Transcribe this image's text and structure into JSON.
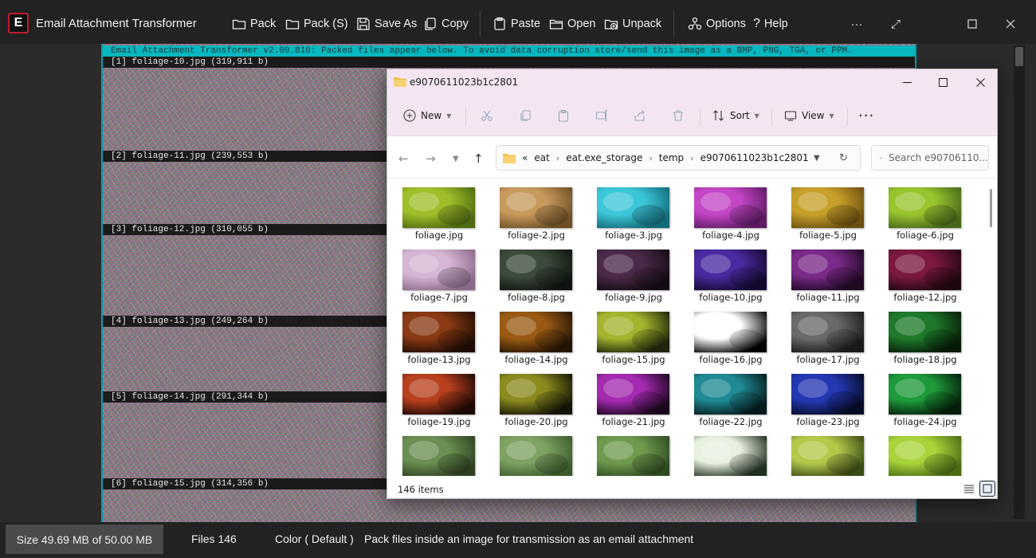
{
  "app": {
    "logo_letter": "E",
    "title": "Email Attachment Transformer",
    "toolbar": {
      "pack": "Pack",
      "pack_s": "Pack (S)",
      "save_as": "Save As",
      "copy": "Copy",
      "paste": "Paste",
      "open": "Open",
      "unpack": "Unpack",
      "options": "Options",
      "help": "Help"
    }
  },
  "image_panel": {
    "header_text": "Email Attachment Transformer v2.00.810: Packed files appear below. To avoid data corruption store/send this image as a BMP, PNG, TGA, or PPM.",
    "files": [
      "[1] foliage-10.jpg (319,911 b)",
      "[2] foliage-11.jpg (239,553 b)",
      "[3] foliage-12.jpg (310,055 b)",
      "[4] foliage-13.jpg (249,264 b)",
      "[5] foliage-14.jpg (291,344 b)",
      "[6] foliage-15.jpg (314,356 b)"
    ]
  },
  "explorer": {
    "title": "e9070611023b1c2801",
    "commands": {
      "new": "New",
      "sort": "Sort",
      "view": "View"
    },
    "breadcrumb": [
      "«",
      "eat",
      "eat.exe_storage",
      "temp",
      "e9070611023b1c2801"
    ],
    "search_placeholder": "Search e90706110...",
    "status_count": "146 items",
    "colors": {
      "title_bg": "#f3e6f2",
      "folder": "#f2c14e"
    },
    "items": [
      {
        "name": "foliage.jpg",
        "color": "#9fbf2a",
        "color2": "#4f6a10"
      },
      {
        "name": "foliage-2.jpg",
        "color": "#c79a5c",
        "color2": "#6e4e24"
      },
      {
        "name": "foliage-3.jpg",
        "color": "#3cc7d8",
        "color2": "#126a78"
      },
      {
        "name": "foliage-4.jpg",
        "color": "#c346c6",
        "color2": "#5e1a62"
      },
      {
        "name": "foliage-5.jpg",
        "color": "#c7a02a",
        "color2": "#6a4e10"
      },
      {
        "name": "foliage-6.jpg",
        "color": "#98c42e",
        "color2": "#47661a"
      },
      {
        "name": "foliage-7.jpg",
        "color": "#d6b6d4",
        "color2": "#8a6a88"
      },
      {
        "name": "foliage-8.jpg",
        "color": "#3c4a3c",
        "color2": "#101410"
      },
      {
        "name": "foliage-9.jpg",
        "color": "#4a2a48",
        "color2": "#140a14"
      },
      {
        "name": "foliage-10.jpg",
        "color": "#4a2aa0",
        "color2": "#14082e"
      },
      {
        "name": "foliage-11.jpg",
        "color": "#7a2a88",
        "color2": "#1e0822"
      },
      {
        "name": "foliage-12.jpg",
        "color": "#7a1840",
        "color2": "#1e0610"
      },
      {
        "name": "foliage-13.jpg",
        "color": "#8a3a14",
        "color2": "#1e0c04"
      },
      {
        "name": "foliage-14.jpg",
        "color": "#9a5a14",
        "color2": "#241404"
      },
      {
        "name": "foliage-15.jpg",
        "color": "#a4b42e",
        "color2": "#20240a"
      },
      {
        "name": "foliage-16.jpg",
        "color": "#ffffff",
        "color2": "#000000"
      },
      {
        "name": "foliage-17.jpg",
        "color": "#6a6a6a",
        "color2": "#1a1a1a"
      },
      {
        "name": "foliage-18.jpg",
        "color": "#1e7a2a",
        "color2": "#061a08"
      },
      {
        "name": "foliage-19.jpg",
        "color": "#b8401e",
        "color2": "#1e0804"
      },
      {
        "name": "foliage-20.jpg",
        "color": "#8a8a1e",
        "color2": "#141406"
      },
      {
        "name": "foliage-21.jpg",
        "color": "#a42ab0",
        "color2": "#1a061c"
      },
      {
        "name": "foliage-22.jpg",
        "color": "#1e8a94",
        "color2": "#061a1c"
      },
      {
        "name": "foliage-23.jpg",
        "color": "#2438b4",
        "color2": "#060a24"
      },
      {
        "name": "foliage-24.jpg",
        "color": "#1e9a3a",
        "color2": "#061c0a"
      },
      {
        "name": "",
        "color": "#6b8f52",
        "color2": "#2e4020"
      },
      {
        "name": "",
        "color": "#7da262",
        "color2": "#3c5a2a"
      },
      {
        "name": "",
        "color": "#6f9a4e",
        "color2": "#2e4a20"
      },
      {
        "name": "",
        "color": "#e8f0e0",
        "color2": "#203020"
      },
      {
        "name": "",
        "color": "#b4c84a",
        "color2": "#3a4a14"
      },
      {
        "name": "",
        "color": "#a8d43a",
        "color2": "#4a6a14"
      }
    ]
  },
  "status_bar": {
    "size": "Size 49.69 MB of 50.00 MB",
    "files": "Files 146",
    "color": "Color ( Default )",
    "hint": "Pack files inside an image for transmission as an email attachment"
  }
}
